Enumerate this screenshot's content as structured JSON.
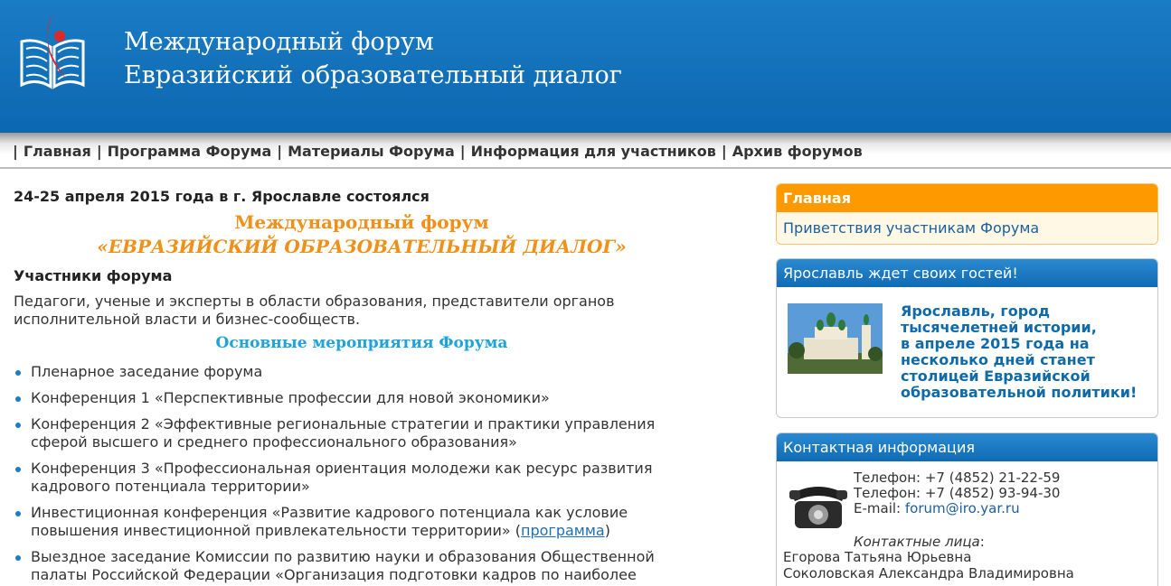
{
  "header": {
    "title_line1": "Международный форум",
    "title_line2": "Евразийский образовательный диалог"
  },
  "nav": {
    "separator": "|",
    "items": [
      "Главная",
      "Программа Форума",
      "Материалы Форума",
      "Информация для участников",
      "Архив форумов"
    ]
  },
  "main": {
    "intro": "24-25 апреля 2015 года в г. Ярославле состоялся",
    "forum_title_line1": "Международный форум",
    "forum_title_line2": "«ЕВРАЗИЙСКИЙ ОБРАЗОВАТЕЛЬНЫЙ ДИАЛОГ»",
    "participants_heading": "Участники форума",
    "participants_text": "Педагоги, ученые и эксперты в области образования, представители органов исполнительной власти и бизнес-сообществ.",
    "events_heading": "Основные мероприятия Форума",
    "events": [
      "Пленарное заседание форума",
      "Конференция 1 «Перспективные профессии для новой экономики»",
      "Конференция 2 «Эффективные региональные стратегии и практики управления сферой высшего и среднего профессионального образования»",
      "Конференция 3 «Профессиональная ориентация молодежи как ресурс развития кадрового потенциала территории»",
      "Инвестиционная конференция «Развитие кадрового потенциала как условие повышения инвестиционной привлекательности территории» (",
      "Выездное заседание Комиссии по развитию науки и образования Общественной палаты Российской Федерации «Организация подготовки кадров по наиболее"
    ],
    "event5_link": "программа",
    "event5_tail": ")"
  },
  "sidebar": {
    "main_box": {
      "header": "Главная",
      "link": "Приветствия участникам Форума"
    },
    "yaroslavl_box": {
      "header": "Ярославль ждет своих гостей!",
      "text_lines": [
        "Ярославль, город",
        "тысячелетней истории,",
        "в апреле 2015 года на",
        "несколько дней станет",
        "столицей Евразийской",
        "образовательной политики!"
      ]
    },
    "contact_box": {
      "header": "Контактная информация",
      "phone1": "Телефон: +7 (4852) 21-22-59",
      "phone2": "Телефон: +7 (4852) 93-94-30",
      "email_label": "E-mail: ",
      "email": "forum@iro.yar.ru",
      "persons_heading": "Контактные лица",
      "persons_colon": ":",
      "persons": [
        "Егорова Татьяна Юрьевна",
        "Соколовская Александра Владимировна"
      ]
    }
  },
  "colors": {
    "header_blue": "#1a7cc4",
    "accent_orange": "#f90",
    "title_orange": "#f09018",
    "heading_cyan": "#1ea4d8",
    "link_blue": "#1e6eb8"
  }
}
